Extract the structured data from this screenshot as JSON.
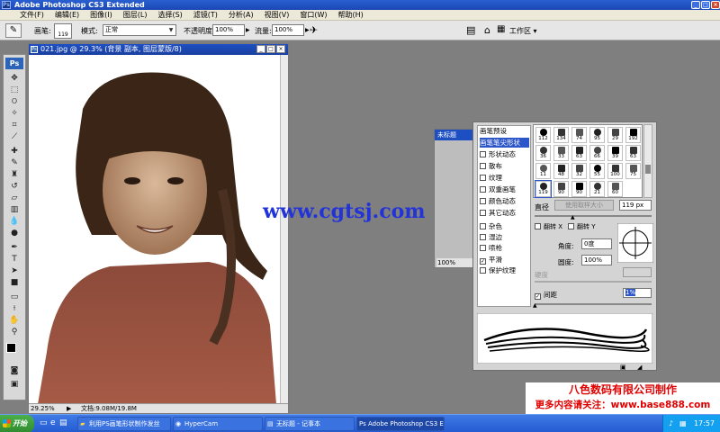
{
  "titlebar": {
    "title": "Adobe Photoshop CS3 Extended"
  },
  "menu": [
    "文件(F)",
    "编辑(E)",
    "图像(I)",
    "图层(L)",
    "选择(S)",
    "滤镜(T)",
    "分析(A)",
    "视图(V)",
    "窗口(W)",
    "帮助(H)"
  ],
  "options": {
    "brush_label": "画笔:",
    "brush_size": "119",
    "mode_label": "模式:",
    "mode_value": "正常",
    "opacity_label": "不透明度:",
    "opacity_value": "100%",
    "flow_label": "流量:",
    "flow_value": "100%",
    "workspace_label": "工作区 ▾"
  },
  "toolbox": {
    "logo": "Ps"
  },
  "document": {
    "title": "021.jpg @ 29.3% (背景 副本, 图层蒙版/8)",
    "zoom": "29.25%",
    "doc_info": "文档:9.08M/19.8M"
  },
  "nav_window": {
    "title": "未标题",
    "zoom": "100%"
  },
  "watermark": "www.cgtsj.com",
  "brush_panel": {
    "presets_label": "画笔预设",
    "tip_shape_label": "画笔笔尖形状",
    "options": [
      {
        "label": "形状动态",
        "checked": false
      },
      {
        "label": "散布",
        "checked": false
      },
      {
        "label": "纹理",
        "checked": false
      },
      {
        "label": "双重画笔",
        "checked": false
      },
      {
        "label": "颜色动态",
        "checked": false
      },
      {
        "label": "其它动态",
        "checked": false
      },
      {
        "label": "杂色",
        "checked": false
      },
      {
        "label": "湿边",
        "checked": false
      },
      {
        "label": "喷枪",
        "checked": false
      },
      {
        "label": "平滑",
        "checked": true
      },
      {
        "label": "保护纹理",
        "checked": false
      }
    ],
    "brush_sizes": [
      "112",
      "134",
      "74",
      "95",
      "29",
      "192",
      "36",
      "33",
      "63",
      "66",
      "39",
      "63",
      "11",
      "48",
      "32",
      "55",
      "100",
      "75",
      "119",
      "90",
      "90",
      "21",
      "60"
    ],
    "diameter_label": "直径",
    "use_sample_label": "使用取样大小",
    "diameter_value": "119 px",
    "flip_x_label": "翻转 X",
    "flip_y_label": "翻转 Y",
    "angle_label": "角度:",
    "angle_value": "0度",
    "roundness_label": "圆度:",
    "roundness_value": "100%",
    "hardness_label": "硬度",
    "spacing_label": "间距",
    "spacing_value": "1%"
  },
  "banner": {
    "line1": "八色数码有限公司制作",
    "line2": "更多内容请关注：www.base888.com"
  },
  "taskbar": {
    "start": "开始",
    "items": [
      "利用PS画笔形状制作发丝",
      "HyperCam",
      "无标题 - 记事本",
      "Adobe Photoshop CS3 E..."
    ],
    "time": "17:57"
  }
}
